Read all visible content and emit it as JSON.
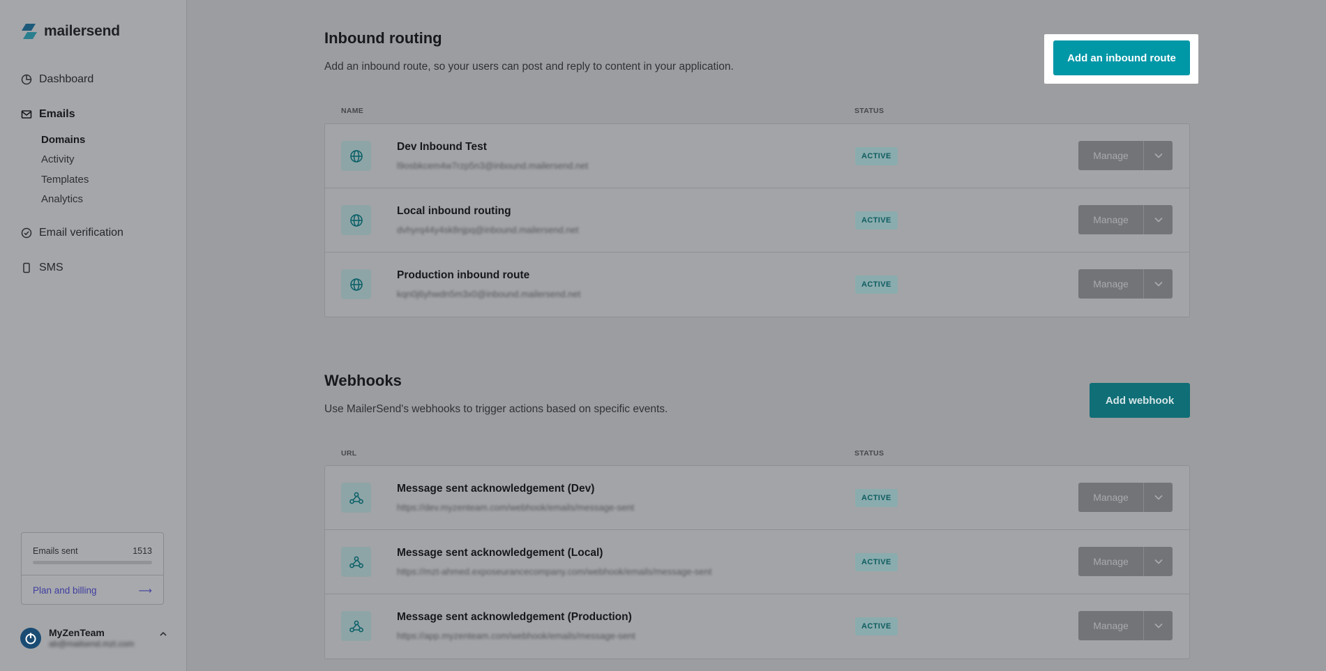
{
  "brand": {
    "name": "mailersend"
  },
  "sidebar": {
    "items": [
      {
        "label": "Dashboard",
        "icon": "dashboard-icon"
      },
      {
        "label": "Emails",
        "icon": "mail-icon"
      },
      {
        "label": "Email verification",
        "icon": "check-circle-icon"
      },
      {
        "label": "SMS",
        "icon": "phone-icon"
      }
    ],
    "email_subitems": [
      {
        "label": "Domains"
      },
      {
        "label": "Activity"
      },
      {
        "label": "Templates"
      },
      {
        "label": "Analytics"
      }
    ],
    "usage": {
      "label": "Emails sent",
      "count": "1513",
      "progress": 0.0,
      "plan_link": "Plan and billing",
      "plan_arrow": "⟶"
    },
    "account": {
      "name": "MyZenTeam",
      "email": "ab@mailsend.mzt.com"
    }
  },
  "inbound": {
    "title": "Inbound routing",
    "description": "Add an inbound route, so your users can post and reply to content in your application.",
    "add_button": "Add an inbound route",
    "col_name": "NAME",
    "col_status": "STATUS",
    "rows": [
      {
        "name": "Dev Inbound Test",
        "address": "l9osbkcem4w7rzp5n3@inbound.mailersend.net",
        "status": "ACTIVE",
        "action": "Manage"
      },
      {
        "name": "Local inbound routing",
        "address": "dvhyrq44y4sk8njpq@inbound.mailersend.net",
        "status": "ACTIVE",
        "action": "Manage"
      },
      {
        "name": "Production inbound route",
        "address": "kqn0j6yhwdn5m3x0@inbound.mailersend.net",
        "status": "ACTIVE",
        "action": "Manage"
      }
    ]
  },
  "webhooks": {
    "title": "Webhooks",
    "description": "Use MailerSend's webhooks to trigger actions based on specific events.",
    "add_button": "Add webhook",
    "col_url": "URL",
    "col_status": "STATUS",
    "rows": [
      {
        "name": "Message sent acknowledgement (Dev)",
        "url": "https://dev.myzenteam.com/webhook/emails/message-sent",
        "status": "ACTIVE",
        "action": "Manage"
      },
      {
        "name": "Message sent acknowledgement (Local)",
        "url": "https://mzt-ahmed.exposeurancecompany.com/webhook/emails/message-sent",
        "status": "ACTIVE",
        "action": "Manage"
      },
      {
        "name": "Message sent acknowledgement (Production)",
        "url": "https://app.myzenteam.com/webhook/emails/message-sent",
        "status": "ACTIVE",
        "action": "Manage"
      }
    ]
  },
  "colors": {
    "accent": "#0097a7",
    "accent_dimmed": "#0f6e76",
    "overlay": "#9c9da0",
    "link": "#3f3ea0"
  }
}
